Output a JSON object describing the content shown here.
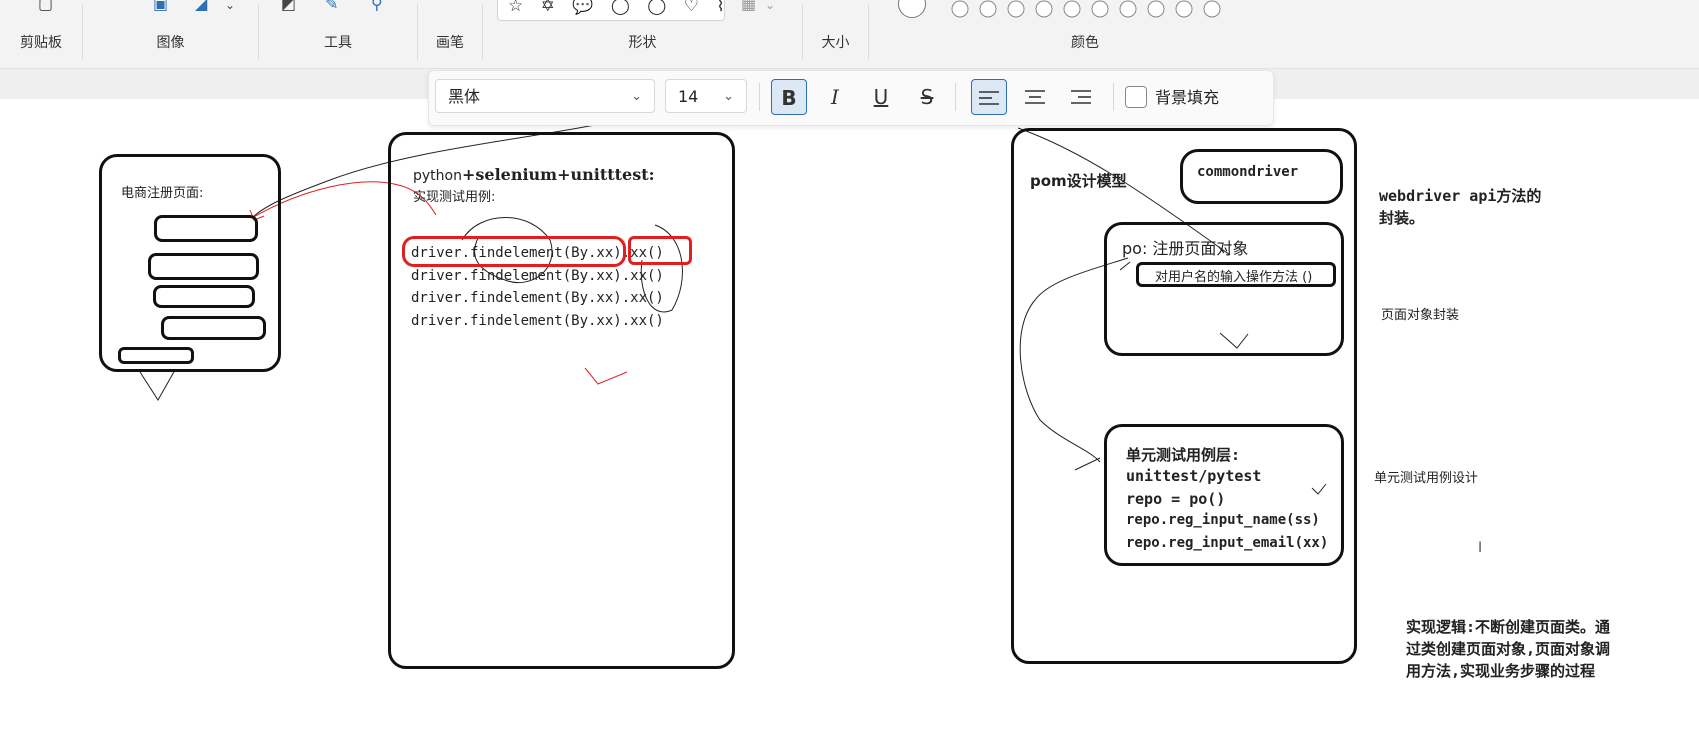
{
  "ribbon": {
    "groups": [
      {
        "name": "clipboard",
        "label": "剪贴板"
      },
      {
        "name": "image",
        "label": "图像"
      },
      {
        "name": "tools",
        "label": "工具"
      },
      {
        "name": "brush",
        "label": "画笔"
      },
      {
        "name": "shapes",
        "label": "形状"
      },
      {
        "name": "size",
        "label": "大小"
      },
      {
        "name": "colors",
        "label": "颜色"
      }
    ],
    "shapes_glyphs": "☆ ✡ 💬 ◯ ◯ ♡ ⌇"
  },
  "format_toolbar": {
    "font": "黑体",
    "size": "14",
    "bold": "B",
    "italic": "I",
    "underline": "U",
    "strike": "S",
    "bg_fill_label": "背景填充"
  },
  "canvas": {
    "left_page_title": "电商注册页面:",
    "middle_title_a": "python",
    "middle_title_b": "+selenium+unitttest:",
    "middle_subtitle": "实现测试用例:",
    "code_lines": [
      "driver.findelement(By.xx).xx()",
      "driver.findelement(By.xx).xx()",
      "driver.findelement(By.xx).xx()",
      "driver.findelement(By.xx).xx()"
    ],
    "pom_title": "pom设计模型",
    "commondriver": "commondriver",
    "po_title": "po: 注册页面对象",
    "po_method": "对用户名的输入操作方法 ()",
    "unit_lines": [
      "单元测试用例层:",
      "unittest/pytest",
      "repo = po()",
      "repo.reg_input_name(ss)",
      "repo.reg_input_email(xx)"
    ],
    "webdriver_note": "webdriver api方法的\n封装。",
    "page_object_note": "页面对象封装",
    "unit_note": "单元测试用例设计",
    "logic_note": "实现逻辑:不断创建页面类。通过类创建页面对象,页面对象调用方法,实现业务步骤的过程"
  },
  "colors": {
    "accent": "#2f6fb6",
    "red": "#e02020",
    "ink": "#111111"
  }
}
